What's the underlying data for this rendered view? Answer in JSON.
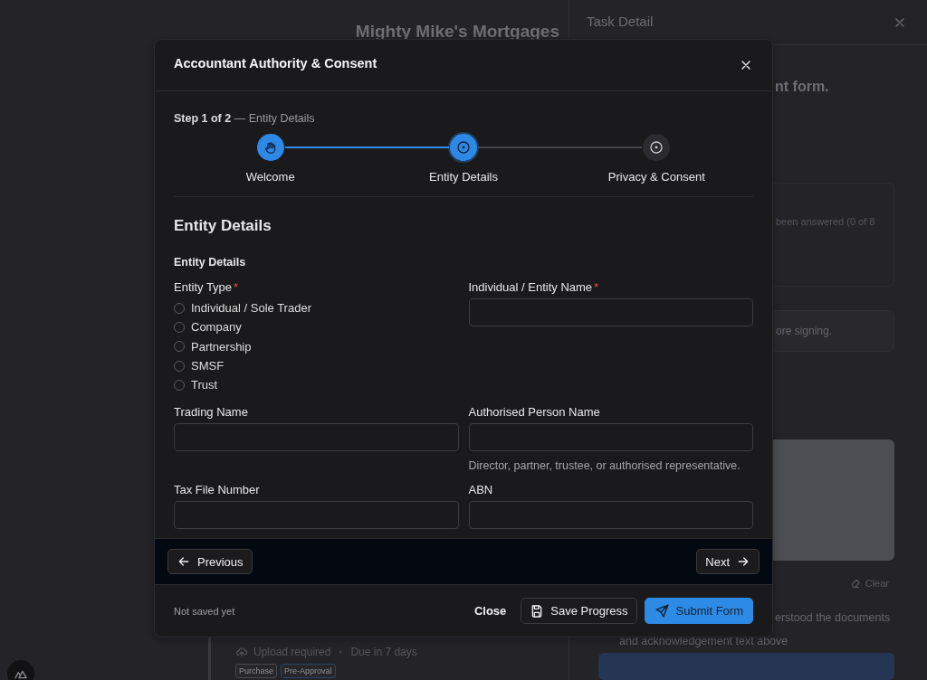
{
  "background": {
    "heading": "Mighty Mike's Mortgages",
    "task_card": {
      "status": "Upload required",
      "due": "Due in 7 days",
      "tags": [
        {
          "label": "Purchase",
          "color": "#48484d"
        },
        {
          "label": "Pre-Approval",
          "color": "#2c4468"
        }
      ]
    }
  },
  "task_panel": {
    "title": "Task Detail",
    "intro_text": "nt form.",
    "progress_text": "been answered (0 of 8",
    "notice_text": "ore signing.",
    "clear_label": "Clear",
    "acknowledgement_lines": [
      "erstood the documents",
      "and acknowledgement text above"
    ]
  },
  "modal": {
    "title": "Accountant Authority & Consent",
    "step_caption": "Step 1 of 2",
    "step_detail": "— Entity Details",
    "steps": [
      {
        "label": "Welcome",
        "complete": true,
        "selected": false
      },
      {
        "label": "Entity Details",
        "complete": false,
        "selected": true
      },
      {
        "label": "Privacy & Consent",
        "complete": false,
        "selected": false
      }
    ],
    "section_title": "Entity Details",
    "group_title": "Entity Details",
    "fields": [
      {
        "kind": "radio",
        "label": "Entity Type",
        "required_mark": "*",
        "options": [
          {
            "label": "Individual / Sole Trader",
            "selected": false
          },
          {
            "label": "Company",
            "selected": false
          },
          {
            "label": "Partnership",
            "selected": false
          },
          {
            "label": "SMSF",
            "selected": false
          },
          {
            "label": "Trust",
            "selected": false
          }
        ]
      },
      {
        "kind": "text",
        "label": "Individual / Entity Name",
        "required_mark": "*"
      },
      {
        "kind": "text",
        "label": "Trading Name"
      },
      {
        "kind": "text",
        "label": "Authorised Person Name",
        "help": "Director, partner, trustee, or authorised representative."
      },
      {
        "kind": "text",
        "label": "Tax File Number"
      },
      {
        "kind": "text",
        "label": "ABN"
      }
    ],
    "nav": {
      "previous": "Previous",
      "next": "Next"
    },
    "footer": {
      "save_status": "Not saved yet",
      "close": "Close",
      "save": "Save Progress",
      "submit": "Submit Form"
    }
  }
}
